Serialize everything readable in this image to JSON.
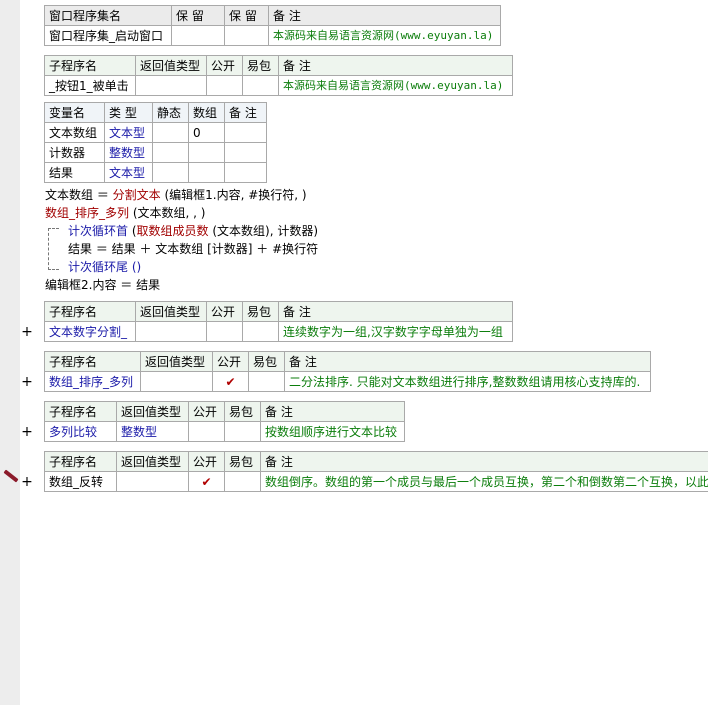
{
  "window_table": {
    "headers": [
      "窗口程序集名",
      "保 留",
      "保 留",
      "备 注"
    ],
    "row": [
      "窗口程序集_启动窗口",
      "",
      "",
      "本源码来自易语言资源网(www.eyuyan.la)"
    ]
  },
  "sub1": {
    "headers": [
      "子程序名",
      "返回值类型",
      "公开",
      "易包",
      "备 注"
    ],
    "row": [
      "_按钮1_被单击",
      "",
      "",
      "",
      "本源码来自易语言资源网(www.eyuyan.la)"
    ]
  },
  "vars": {
    "headers": [
      "变量名",
      "类 型",
      "静态",
      "数组",
      "备 注"
    ],
    "rows": [
      [
        "文本数组",
        "文本型",
        "",
        "0",
        ""
      ],
      [
        "计数器",
        "整数型",
        "",
        "",
        ""
      ],
      [
        "结果",
        "文本型",
        "",
        "",
        ""
      ]
    ]
  },
  "code": {
    "l1a": "文本数组 ＝ ",
    "l1b": "分割文本",
    "l1c": " (编辑框1.内容, #换行符, )",
    "l2a": "数组_排序_多列",
    "l2b": " (文本数组, , )",
    "l3a": "计次循环首",
    "l3b": " (",
    "l3c": "取数组成员数",
    "l3d": " (文本数组), 计数器)",
    "l4": "结果 ＝ 结果 ＋ 文本数组 [计数器] ＋ #换行符",
    "l5": "计次循环尾 ()",
    "l6": "编辑框2.内容 ＝ 结果"
  },
  "sub2": {
    "headers": [
      "子程序名",
      "返回值类型",
      "公开",
      "易包",
      "备 注"
    ],
    "row": [
      "文本数字分割_",
      "",
      "",
      "",
      "连续数字为一组,汉字数字字母单独为一组"
    ]
  },
  "sub3": {
    "headers": [
      "子程序名",
      "返回值类型",
      "公开",
      "易包",
      "备 注"
    ],
    "row": [
      "数组_排序_多列",
      "",
      "✔",
      "",
      "二分法排序. 只能对文本数组进行排序,整数数组请用核心支持库的."
    ]
  },
  "sub4": {
    "headers": [
      "子程序名",
      "返回值类型",
      "公开",
      "易包",
      "备 注"
    ],
    "row": [
      "多列比较",
      "整数型",
      "",
      "",
      "按数组顺序进行文本比较"
    ]
  },
  "sub5": {
    "headers": [
      "子程序名",
      "返回值类型",
      "公开",
      "易包",
      "备 注"
    ],
    "row": [
      "数组_反转",
      "",
      "✔",
      "",
      "数组倒序。数组的第一个成员与最后一个成员互换，第二个和倒数第二个互换，以此"
    ]
  },
  "expand_label": "+"
}
